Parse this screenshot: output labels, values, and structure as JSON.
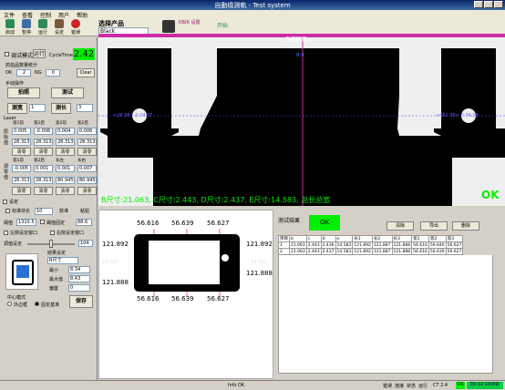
{
  "window": {
    "title": "自動檢測軌  - Test system"
  },
  "menu": [
    "文件",
    "查看",
    "控制",
    "用户",
    "帮助"
  ],
  "toolbar": {
    "buttons": [
      {
        "label": "启动",
        "icon": "play-icon",
        "color": "#2e8b57"
      },
      {
        "label": "暂停",
        "icon": "pause-icon",
        "color": "#3a6ea5"
      },
      {
        "label": "运行",
        "icon": "run-icon",
        "color": "#2e8b57"
      },
      {
        "label": "设定",
        "icon": "settings-icon",
        "color": "#7a5a3a"
      },
      {
        "label": "错误",
        "icon": "stop-icon",
        "color": "#cc2222"
      }
    ],
    "product_label": "选择产品",
    "product_value": "Black",
    "param_label": "RBIR\n设置",
    "start_label": "开始"
  },
  "left": {
    "debug_mode_label": "调试模式",
    "run_label": "运行",
    "cycle_label": "CycleTime",
    "cycle_value": "2.42",
    "group_title": "抓拍品数量统计",
    "ok_label": "OK",
    "ok_value": "2",
    "ng_label": "NG",
    "ng_value": "0",
    "clear_label": "Clear",
    "manual_title": "手动操作",
    "capture_label": "拍照",
    "test_label": "测试",
    "width_label": "测宽",
    "width_sel": "1",
    "length_label": "测长",
    "length_sel": "3",
    "laser_title": "Laser",
    "grid1_headers": [
      "宽1前",
      "宽1后",
      "宽2前",
      "宽2后"
    ],
    "grid1_row1": [
      "0.005",
      "-0.008",
      "0.004",
      "0.006"
    ],
    "grid1_row2": [
      "28.313",
      "28.313",
      "28.313",
      "28.313"
    ],
    "clear_btn": "清零",
    "grid2_headers": [
      "宽1前",
      "宽2后",
      "长左",
      "长右"
    ],
    "grid2_row1": [
      "-0.005",
      "0.001",
      "0.001",
      "0.007"
    ],
    "grid2_row2": [
      "28.313",
      "28.313",
      "80.945",
      "80.945"
    ],
    "side_label_top": "原始值",
    "side_label_bottom": "调零值",
    "settings_title": "设定",
    "std_label": "标准块长",
    "std_value": "10",
    "soft_label": "软准",
    "calib_label": "粘贴",
    "thr_label": "阈值",
    "thr_value": "1310.5",
    "thr_label2": "阈值固定",
    "thr_value2": "88.6",
    "left_win_label": "左侧设定窗口",
    "right_win_label": "右侧设定窗口",
    "adjust_label": "调值设定",
    "adjust_value": "104",
    "result_label": "结果设定",
    "result_sel": "R尺寸",
    "min_label": "最小",
    "min_value": "8.34",
    "max_label": "最大值",
    "max_value": "8.43",
    "offset_label": "偏置",
    "offset_value": "0",
    "center_title": "中心模式",
    "outer_label": "外边框",
    "fixed_label": "固定基准",
    "save_label": "保存"
  },
  "camera": {
    "top_label": "左侧图像",
    "left_coord": "<26 36> 2  74.37",
    "right_coord": "<461 36> 7 74.39",
    "center_marker": "B-9",
    "measure_text": "B尺寸:21.063, C尺寸:2.443, D尺寸:2.437, E尺寸:14.583, 总长总宽",
    "ok_text": "OK"
  },
  "diagram": {
    "top_vals": [
      "56.616",
      "56.639",
      "56.627"
    ],
    "bottom_vals": [
      "56.616",
      "56.639",
      "56.627"
    ],
    "left_vals": [
      "121.892",
      "121.888"
    ],
    "right_vals": [
      "121.892",
      "121.888"
    ],
    "mid_left": "14.582",
    "mid_right": "14.582"
  },
  "results": {
    "title": "测试结果",
    "ok_badge": "OK",
    "clear_btn": "清除",
    "export_btn": "导出",
    "delete_btn": "删除",
    "headers": [
      "项目",
      "b",
      "c",
      "d",
      "e",
      "长1",
      "长2",
      "长3",
      "宽1",
      "宽2",
      "宽3"
    ],
    "rows": [
      [
        "1",
        "21.063",
        "2.443",
        "2.436",
        "14.583",
        "121.892",
        "121.887",
        "121.888",
        "56.616",
        "56.640",
        "56.627"
      ],
      [
        "2",
        "21.063",
        "2.443",
        "2.437",
        "14.583",
        "121.892",
        "121.887",
        "121.888",
        "56.616",
        "56.639",
        "56.627"
      ]
    ]
  },
  "status": {
    "center": "Info OK",
    "items": [
      "错误",
      "连接",
      "状态",
      "运行"
    ],
    "code": "CT 2.4",
    "ok_label": "OK",
    "time": "09:32:10(89)"
  }
}
